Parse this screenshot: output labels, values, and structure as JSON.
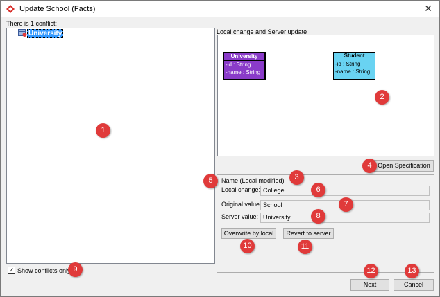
{
  "window": {
    "title": "Update School (Facts)",
    "close_glyph": "✕"
  },
  "left": {
    "conflict_count_text": "There is 1 conflict:",
    "tree_items": [
      {
        "label": "University",
        "icon": "class-conflict-icon"
      }
    ],
    "show_conflicts_label": "Show conflicts only",
    "show_conflicts_checked": true
  },
  "right": {
    "preview_label": "Local change and Server update",
    "diagram": {
      "classes": [
        {
          "name": "University",
          "attributes": [
            "-id : String",
            "-name : String"
          ],
          "color": "#8a3bc9"
        },
        {
          "name": "Student",
          "attributes": [
            "-id : String",
            "-name : String"
          ],
          "color": "#69d3f2"
        }
      ]
    },
    "open_spec_label": "Open Specification",
    "property_heading": "Name (Local modified)",
    "fields": [
      {
        "label": "Local change:",
        "value": "College"
      },
      {
        "label": "Original value:",
        "value": "School"
      },
      {
        "label": "Server value:",
        "value": "University"
      }
    ],
    "overwrite_label": "Overwrite by local",
    "revert_label": "Revert to server"
  },
  "footer": {
    "next_label": "Next",
    "cancel_label": "Cancel"
  },
  "markers": [
    "1",
    "2",
    "3",
    "4",
    "5",
    "6",
    "7",
    "8",
    "9",
    "10",
    "11",
    "12",
    "13"
  ],
  "colors": {
    "marker": "#e03a3a",
    "selection": "#3399ff"
  }
}
